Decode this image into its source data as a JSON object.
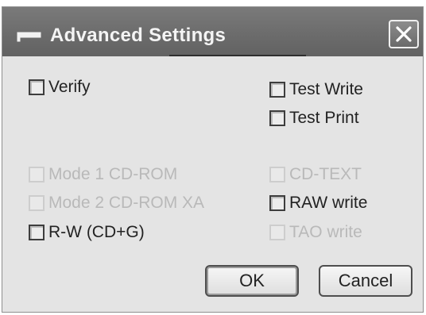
{
  "dialog": {
    "title": "Advanced Settings",
    "icons": {
      "app": "drive-icon",
      "close": "close-icon"
    }
  },
  "options": {
    "verify": {
      "label": "Verify",
      "checked": false,
      "enabled": true
    },
    "test_write": {
      "label": "Test Write",
      "checked": false,
      "enabled": true
    },
    "test_print": {
      "label": "Test Print",
      "checked": false,
      "enabled": true
    },
    "mode1": {
      "label": "Mode 1 CD-ROM",
      "checked": false,
      "enabled": false
    },
    "mode2": {
      "label": "Mode 2 CD-ROM XA",
      "checked": false,
      "enabled": false
    },
    "rw": {
      "label": "R-W (CD+G)",
      "checked": false,
      "enabled": true
    },
    "cd_text": {
      "label": "CD-TEXT",
      "checked": false,
      "enabled": false
    },
    "raw_write": {
      "label": "RAW write",
      "checked": false,
      "enabled": true
    },
    "tao_write": {
      "label": "TAO write",
      "checked": false,
      "enabled": false
    }
  },
  "buttons": {
    "ok": "OK",
    "cancel": "Cancel"
  }
}
